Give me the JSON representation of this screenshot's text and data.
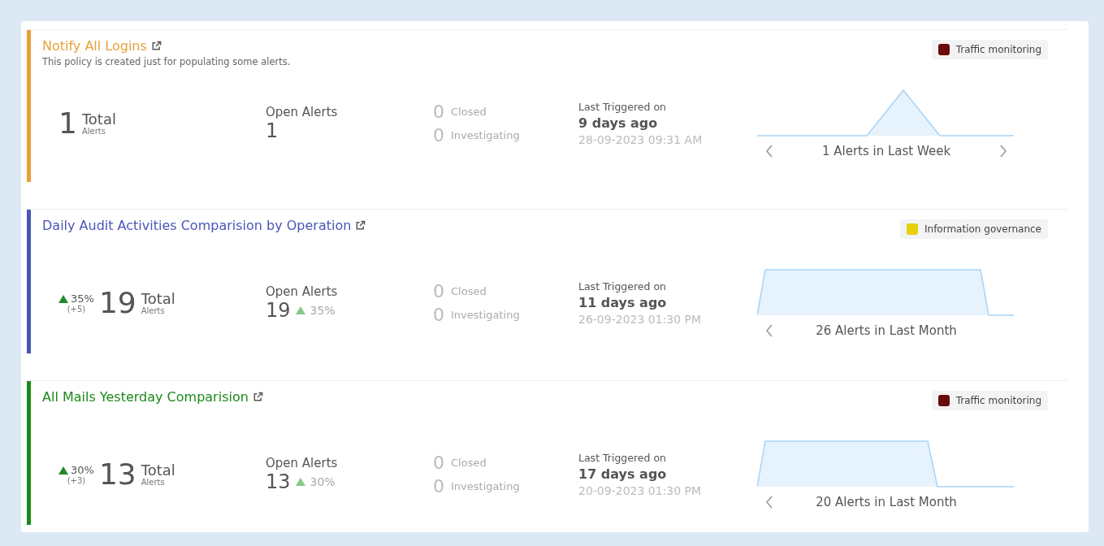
{
  "policies": [
    {
      "title": "Notify All Logins",
      "color": "#e8a03c",
      "description": "This policy is created just for populating some alerts.",
      "tag": {
        "label": "Traffic monitoring",
        "color": "#6b0a0a"
      },
      "total": "1",
      "total_label": "Total",
      "total_sub": "Alerts",
      "open_label": "Open Alerts",
      "open": "1",
      "closed": "0",
      "closed_label": "Closed",
      "investigating": "0",
      "investigating_label": "Investigating",
      "last_label": "Last Triggered on",
      "last_ago": "9 days ago",
      "last_date": "28-09-2023 09:31 AM",
      "sparkline": {
        "kind": "peak"
      },
      "period": "1 Alerts in Last Week",
      "has_next": true
    },
    {
      "title": "Daily Audit Activities Comparision by Operation",
      "color": "#4a55b8",
      "tag": {
        "label": "Information governance",
        "color": "#e6d10a"
      },
      "trend": "35%",
      "trend_delta": "(+5)",
      "total": "19",
      "total_label": "Total",
      "total_sub": "Alerts",
      "open_label": "Open Alerts",
      "open": "19",
      "open_trend": "35%",
      "closed": "0",
      "closed_label": "Closed",
      "investigating": "0",
      "investigating_label": "Investigating",
      "last_label": "Last Triggered on",
      "last_ago": "11 days ago",
      "last_date": "26-09-2023 01:30 PM",
      "sparkline": {
        "kind": "plateau-long"
      },
      "period": "26 Alerts in Last Month",
      "has_next": false
    },
    {
      "title": "All Mails Yesterday Comparision",
      "color": "#1a8a1a",
      "tag": {
        "label": "Traffic monitoring",
        "color": "#6b0a0a"
      },
      "trend": "30%",
      "trend_delta": "(+3)",
      "total": "13",
      "total_label": "Total",
      "total_sub": "Alerts",
      "open_label": "Open Alerts",
      "open": "13",
      "open_trend": "30%",
      "closed": "0",
      "closed_label": "Closed",
      "investigating": "0",
      "investigating_label": "Investigating",
      "last_label": "Last Triggered on",
      "last_ago": "17 days ago",
      "last_date": "20-09-2023 01:30 PM",
      "sparkline": {
        "kind": "plateau-short"
      },
      "period": "20 Alerts in Last Month",
      "has_next": false
    }
  ]
}
